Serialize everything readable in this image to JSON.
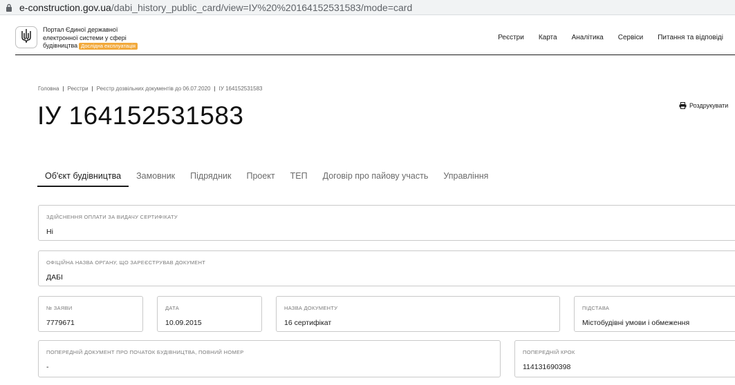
{
  "browser": {
    "url_domain": "e-construction.gov.ua",
    "url_path": "/dabi_history_public_card/view=ІУ%20%20164152531583/mode=card"
  },
  "header": {
    "site_name_line1": "Портал Єдиної державної",
    "site_name_line2": "електронної системи у сфері",
    "site_name_line3": "будівництва",
    "beta_badge": "Дослідна експлуатація",
    "nav": [
      "Реєстри",
      "Карта",
      "Аналітика",
      "Сервіси",
      "Питання та відповіді"
    ]
  },
  "breadcrumb": [
    "Головна",
    "Реєстри",
    "Реєстр дозвільних документів до 06.07.2020",
    "ІУ 164152531583"
  ],
  "page_title": "ІУ 164152531583",
  "print_label": "Роздрукувати",
  "tabs": [
    "Об'єкт будівництва",
    "Замовник",
    "Підрядник",
    "Проект",
    "ТЕП",
    "Договір про пайову участь",
    "Управління"
  ],
  "active_tab_index": 0,
  "fields": {
    "payment": {
      "label": "Здійснення оплати за видачу сертифікату",
      "value": "Ні"
    },
    "organ": {
      "label": "Офіційна назва органу, що зареєстрував документ",
      "value": "ДАБІ"
    },
    "app_number": {
      "label": "№ заяви",
      "value": "7779671"
    },
    "date": {
      "label": "Дата",
      "value": "10.09.2015"
    },
    "doc_name": {
      "label": "Назва документу",
      "value": "16 сертифікат"
    },
    "basis": {
      "label": "Підстава",
      "value": "Містобудівні умови і обмеження"
    },
    "prev_doc": {
      "label": "Попередній документ про початок будівництва, повний номер",
      "value": "-"
    },
    "prev_step": {
      "label": "Попередній крок",
      "value": "114131690398"
    }
  },
  "colors": {
    "accent_badge": "#f2a93b",
    "text": "#1a1a1a",
    "muted": "#6b6b6b",
    "border": "#c9c9c9"
  },
  "icons": {
    "lock": "lock-icon",
    "logo": "trident-icon",
    "print": "printer-icon"
  }
}
